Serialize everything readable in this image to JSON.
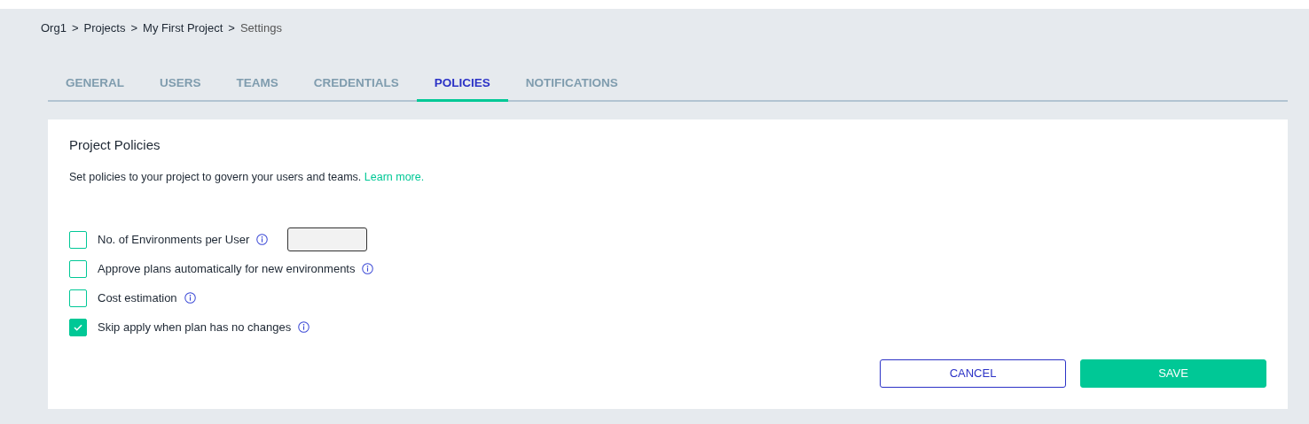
{
  "breadcrumb": {
    "items": [
      {
        "label": "Org1",
        "current": false
      },
      {
        "label": "Projects",
        "current": false
      },
      {
        "label": "My First Project",
        "current": false
      },
      {
        "label": "Settings",
        "current": true
      }
    ],
    "separators": [
      ">",
      ">",
      ">"
    ]
  },
  "tabs": [
    {
      "label": "GENERAL",
      "selected": false
    },
    {
      "label": "USERS",
      "selected": false
    },
    {
      "label": "TEAMS",
      "selected": false
    },
    {
      "label": "CREDENTIALS",
      "selected": false
    },
    {
      "label": "POLICIES",
      "selected": true
    },
    {
      "label": "NOTIFICATIONS",
      "selected": false
    }
  ],
  "panel": {
    "title": "Project Policies",
    "description": "Set policies to your project to govern your users and teams.",
    "link": "Learn more.",
    "policies": [
      {
        "kind": "with-field",
        "label": "No. of Environments per User",
        "checked": false
      },
      {
        "kind": "plain",
        "label": "Approve plans automatically for new environments",
        "checked": false
      },
      {
        "kind": "plain",
        "label": "Cost estimation",
        "checked": false
      },
      {
        "kind": "plain",
        "label": "Skip apply when plan has no changes",
        "checked": true
      }
    ],
    "buttons": [
      {
        "kind": "secondary",
        "label": "CANCEL"
      },
      {
        "kind": "primary",
        "label": "SAVE"
      }
    ]
  }
}
